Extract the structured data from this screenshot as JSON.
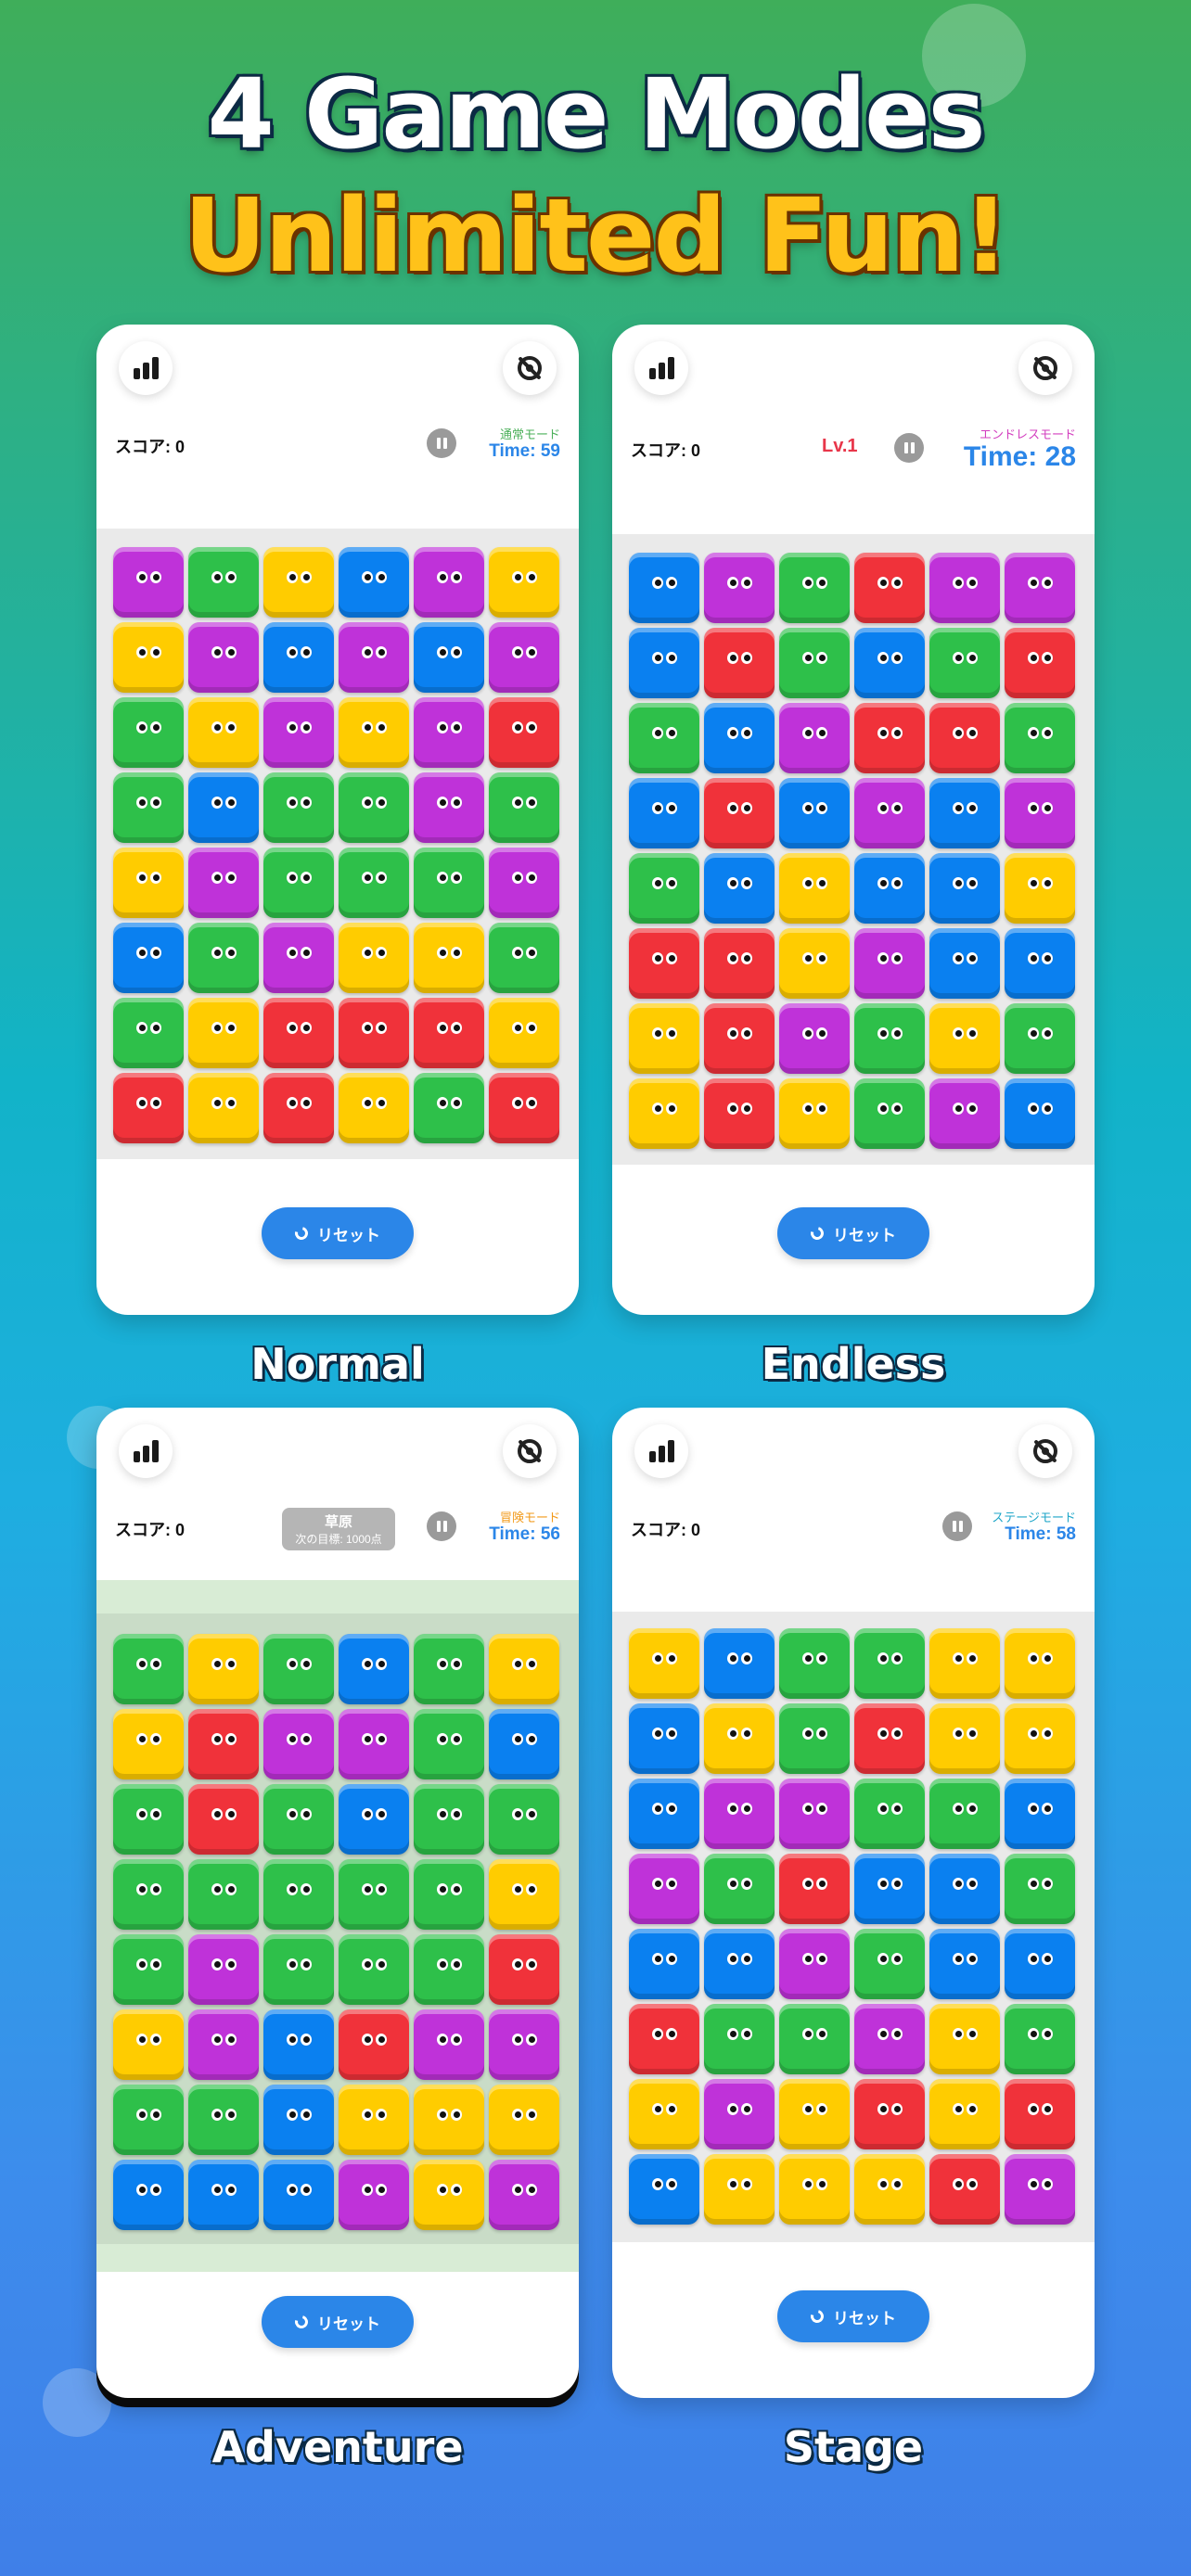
{
  "headline": {
    "line1": "4 Game Modes",
    "line2": "Unlimited Fun!"
  },
  "common": {
    "reset_label": "リセット",
    "score_label": "スコア: 0"
  },
  "modes": [
    {
      "label": "Normal",
      "mode_tag": "通常モード",
      "mode_tag_color": "#4bb05a",
      "time": "Time: 59",
      "grid": [
        [
          "p",
          "g",
          "y",
          "b",
          "p",
          "y"
        ],
        [
          "y",
          "p",
          "b",
          "p",
          "b",
          "p"
        ],
        [
          "g",
          "y",
          "p",
          "y",
          "p",
          "r"
        ],
        [
          "g",
          "b",
          "g",
          "g",
          "p",
          "g"
        ],
        [
          "y",
          "p",
          "g",
          "g",
          "g",
          "p"
        ],
        [
          "b",
          "g",
          "p",
          "y",
          "y",
          "g"
        ],
        [
          "g",
          "y",
          "r",
          "r",
          "r",
          "y"
        ],
        [
          "r",
          "y",
          "r",
          "y",
          "g",
          "r"
        ]
      ]
    },
    {
      "label": "Endless",
      "mode_tag": "エンドレスモード",
      "mode_tag_color": "#d33fbf",
      "time": "Time: 28",
      "level": "Lv.1",
      "grid": [
        [
          "b",
          "p",
          "g",
          "r",
          "p",
          "p"
        ],
        [
          "b",
          "r",
          "g",
          "b",
          "g",
          "r"
        ],
        [
          "g",
          "b",
          "p",
          "r",
          "r",
          "g"
        ],
        [
          "b",
          "r",
          "b",
          "p",
          "b",
          "p"
        ],
        [
          "g",
          "b",
          "y",
          "b",
          "b",
          "y"
        ],
        [
          "r",
          "r",
          "y",
          "p",
          "b",
          "b"
        ],
        [
          "y",
          "r",
          "p",
          "g",
          "y",
          "g"
        ],
        [
          "y",
          "r",
          "y",
          "g",
          "p",
          "b"
        ]
      ]
    },
    {
      "label": "Adventure",
      "mode_tag": "冒険モード",
      "mode_tag_color": "#f29a1a",
      "time": "Time: 56",
      "goal": {
        "title": "草原",
        "subtitle": "次の目標: 1000点"
      },
      "grid": [
        [
          "g",
          "y",
          "g",
          "b",
          "g",
          "y"
        ],
        [
          "y",
          "r",
          "p",
          "p",
          "g",
          "b"
        ],
        [
          "g",
          "r",
          "g",
          "b",
          "g",
          "g"
        ],
        [
          "g",
          "g",
          "g",
          "g",
          "g",
          "y"
        ],
        [
          "g",
          "p",
          "g",
          "g",
          "g",
          "r"
        ],
        [
          "y",
          "p",
          "b",
          "r",
          "p",
          "p"
        ],
        [
          "g",
          "g",
          "b",
          "y",
          "y",
          "y"
        ],
        [
          "b",
          "b",
          "b",
          "p",
          "y",
          "p"
        ]
      ]
    },
    {
      "label": "Stage",
      "mode_tag": "ステージモード",
      "mode_tag_color": "#1fa6c8",
      "time": "Time: 58",
      "grid": [
        [
          "y",
          "b",
          "g",
          "g",
          "y",
          "y"
        ],
        [
          "b",
          "y",
          "g",
          "r",
          "y",
          "y"
        ],
        [
          "b",
          "p",
          "p",
          "g",
          "g",
          "b"
        ],
        [
          "p",
          "g",
          "r",
          "b",
          "b",
          "g"
        ],
        [
          "b",
          "b",
          "p",
          "g",
          "b",
          "b"
        ],
        [
          "r",
          "g",
          "g",
          "p",
          "y",
          "g"
        ],
        [
          "y",
          "p",
          "y",
          "r",
          "y",
          "r"
        ],
        [
          "b",
          "y",
          "y",
          "y",
          "r",
          "p"
        ]
      ]
    }
  ]
}
